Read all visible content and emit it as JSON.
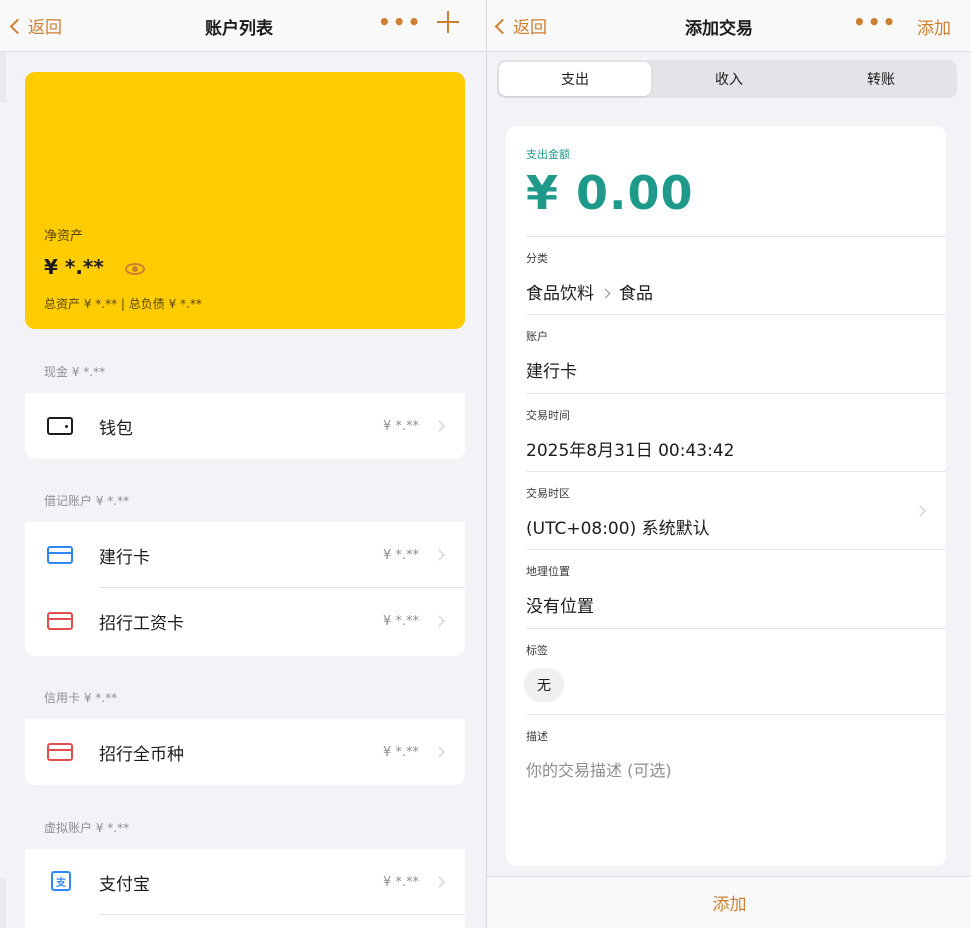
{
  "left": {
    "nav": {
      "back": "返回",
      "title": "账户列表",
      "more": "•••"
    },
    "net": {
      "label": "净资产",
      "value": "¥ *.**",
      "sub": "总资产 ¥ *.** | 总负债 ¥ *.**"
    },
    "groups": [
      {
        "header": "现金  ¥ *.**",
        "rows": [
          {
            "label": "钱包",
            "value": "¥ *.**",
            "icon": "wallet-icon"
          }
        ]
      },
      {
        "header": "借记账户  ¥ *.**",
        "rows": [
          {
            "label": "建行卡",
            "value": "¥ *.**",
            "icon": "card-icon"
          },
          {
            "label": "招行工资卡",
            "value": "¥ *.**",
            "icon": "card-icon"
          }
        ]
      },
      {
        "header": "信用卡  ¥ *.**",
        "rows": [
          {
            "label": "招行全币种",
            "value": "¥ *.**",
            "icon": "card-icon"
          }
        ]
      },
      {
        "header": "虚拟账户  ¥ *.**",
        "rows": [
          {
            "label": "支付宝",
            "value": "¥ *.**",
            "icon": "alipay-icon"
          }
        ]
      }
    ]
  },
  "right": {
    "nav": {
      "back": "返回",
      "title": "添加交易",
      "more": "•••",
      "add": "添加"
    },
    "tabs": [
      "支出",
      "收入",
      "转账"
    ],
    "selected_tab": "支出",
    "amount_label": "支出金额",
    "amount": "¥ 0.00",
    "category_label": "分类",
    "category_parent": "食品饮料",
    "category_child": "食品",
    "account_label": "账户",
    "account": "建行卡",
    "time_label": "交易时间",
    "time": "2025年8月31日 00:43:42",
    "tz_label": "交易时区",
    "tz": "(UTC+08:00) 系统默认",
    "location_label": "地理位置",
    "location": "没有位置",
    "tags_label": "标签",
    "tag": "无",
    "desc_label": "描述",
    "desc_placeholder": "你的交易描述 (可选)",
    "bottom_add": "添加"
  },
  "colors": {
    "accent": "#cd7f32",
    "card": "#ffcc00",
    "amount": "#1f9a8a",
    "blue": "#2f87f5",
    "red": "#e34d4d"
  }
}
